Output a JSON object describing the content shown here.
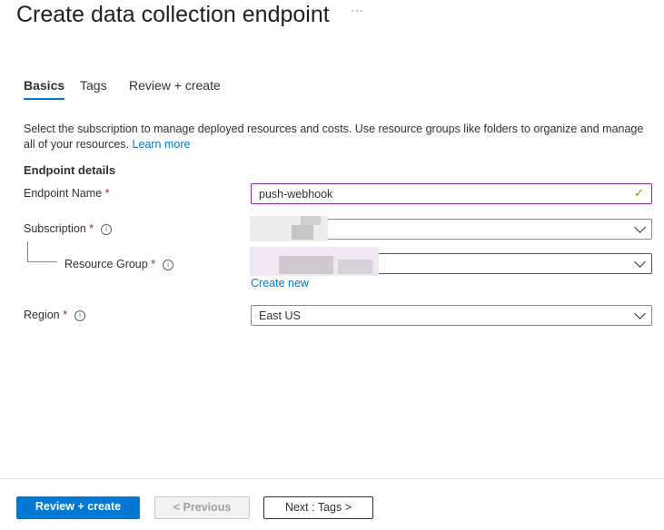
{
  "header": {
    "title": "Create data collection endpoint",
    "more": "···"
  },
  "tabs": [
    {
      "label": "Basics",
      "active": true
    },
    {
      "label": "Tags"
    },
    {
      "label": "Review + create"
    }
  ],
  "description": {
    "text": "Select the subscription to manage deployed resources and costs. Use resource groups like folders to organize and manage all of your resources.",
    "link": "Learn more"
  },
  "section": "Endpoint details",
  "form": {
    "endpoint_name": {
      "label": "Endpoint Name",
      "value": "push-webhook"
    },
    "subscription": {
      "label": "Subscription"
    },
    "resource_group": {
      "label": "Resource Group",
      "create_new": "Create new"
    },
    "region": {
      "label": "Region",
      "value": "East US"
    },
    "required_mark": "*",
    "info_glyph": "i"
  },
  "footer": {
    "review_create": "Review + create",
    "previous": "< Previous",
    "next": "Next : Tags >"
  },
  "colors": {
    "accent": "#0078d4",
    "focus_border": "#8a2da5",
    "required": "#a4262c",
    "valid": "#57a300"
  }
}
